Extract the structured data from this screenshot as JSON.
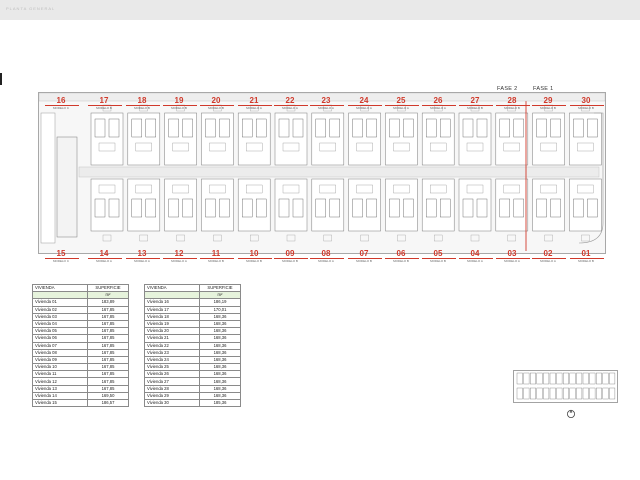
{
  "header": {
    "title": "PLANTA GENERAL"
  },
  "phases": {
    "left": "FASE 2",
    "right": "FASE 1"
  },
  "units_top": [
    {
      "num": "16",
      "model": "MODELO C"
    },
    {
      "num": "17",
      "model": "MODELO B"
    },
    {
      "num": "18",
      "model": "MODELO B"
    },
    {
      "num": "19",
      "model": "MODELO B"
    },
    {
      "num": "20",
      "model": "MODELO B"
    },
    {
      "num": "21",
      "model": "MODELO A"
    },
    {
      "num": "22",
      "model": "MODELO A"
    },
    {
      "num": "23",
      "model": "MODELO A"
    },
    {
      "num": "24",
      "model": "MODELO A"
    },
    {
      "num": "25",
      "model": "MODELO A"
    },
    {
      "num": "26",
      "model": "MODELO A"
    },
    {
      "num": "27",
      "model": "MODELO B"
    },
    {
      "num": "28",
      "model": "MODELO B"
    },
    {
      "num": "29",
      "model": "MODELO B"
    },
    {
      "num": "30",
      "model": "MODELO B"
    }
  ],
  "units_bottom": [
    {
      "num": "15",
      "model": "MODELO C"
    },
    {
      "num": "14",
      "model": "MODELO A"
    },
    {
      "num": "13",
      "model": "MODELO A"
    },
    {
      "num": "12",
      "model": "MODELO A"
    },
    {
      "num": "11",
      "model": "MODELO B"
    },
    {
      "num": "10",
      "model": "MODELO B"
    },
    {
      "num": "09",
      "model": "MODELO B"
    },
    {
      "num": "08",
      "model": "MODELO A"
    },
    {
      "num": "07",
      "model": "MODELO B"
    },
    {
      "num": "06",
      "model": "MODELO B"
    },
    {
      "num": "05",
      "model": "MODELO B"
    },
    {
      "num": "04",
      "model": "MODELO A"
    },
    {
      "num": "03",
      "model": "MODELO A"
    },
    {
      "num": "02",
      "model": "MODELO A"
    },
    {
      "num": "01",
      "model": "MODELO B"
    }
  ],
  "table_left": {
    "col_name": "VIVIENDA",
    "col_area": "SUPERFICIE",
    "unit": "m²",
    "rows": [
      {
        "name": "Vivienda 01",
        "area": "183,89"
      },
      {
        "name": "Vivienda 02",
        "area": "167,85"
      },
      {
        "name": "Vivienda 03",
        "area": "167,85"
      },
      {
        "name": "Vivienda 04",
        "area": "167,85"
      },
      {
        "name": "Vivienda 05",
        "area": "167,85"
      },
      {
        "name": "Vivienda 06",
        "area": "167,85"
      },
      {
        "name": "Vivienda 07",
        "area": "167,85"
      },
      {
        "name": "Vivienda 08",
        "area": "167,85"
      },
      {
        "name": "Vivienda 09",
        "area": "167,85"
      },
      {
        "name": "Vivienda 10",
        "area": "167,85"
      },
      {
        "name": "Vivienda 11",
        "area": "167,85"
      },
      {
        "name": "Vivienda 12",
        "area": "167,85"
      },
      {
        "name": "Vivienda 13",
        "area": "167,85"
      },
      {
        "name": "Vivienda 14",
        "area": "169,50"
      },
      {
        "name": "Vivienda 15",
        "area": "186,57"
      }
    ]
  },
  "table_right": {
    "col_name": "VIVIENDA",
    "col_area": "SUPERFICIE",
    "unit": "m²",
    "rows": [
      {
        "name": "Vivienda 16",
        "area": "186,19"
      },
      {
        "name": "Vivienda 17",
        "area": "170,01"
      },
      {
        "name": "Vivienda 18",
        "area": "168,36"
      },
      {
        "name": "Vivienda 19",
        "area": "168,36"
      },
      {
        "name": "Vivienda 20",
        "area": "168,36"
      },
      {
        "name": "Vivienda 21",
        "area": "168,36"
      },
      {
        "name": "Vivienda 22",
        "area": "168,36"
      },
      {
        "name": "Vivienda 23",
        "area": "168,36"
      },
      {
        "name": "Vivienda 24",
        "area": "168,36"
      },
      {
        "name": "Vivienda 25",
        "area": "168,36"
      },
      {
        "name": "Vivienda 26",
        "area": "168,36"
      },
      {
        "name": "Vivienda 27",
        "area": "168,36"
      },
      {
        "name": "Vivienda 28",
        "area": "168,36"
      },
      {
        "name": "Vivienda 29",
        "area": "168,36"
      },
      {
        "name": "Vivienda 30",
        "area": "185,36"
      }
    ]
  },
  "colors": {
    "accent": "#d0392b",
    "table_unit_row": "#e6f3dc",
    "plan_line": "#7a7a7a"
  },
  "icons": {
    "north": "north-arrow-icon"
  }
}
